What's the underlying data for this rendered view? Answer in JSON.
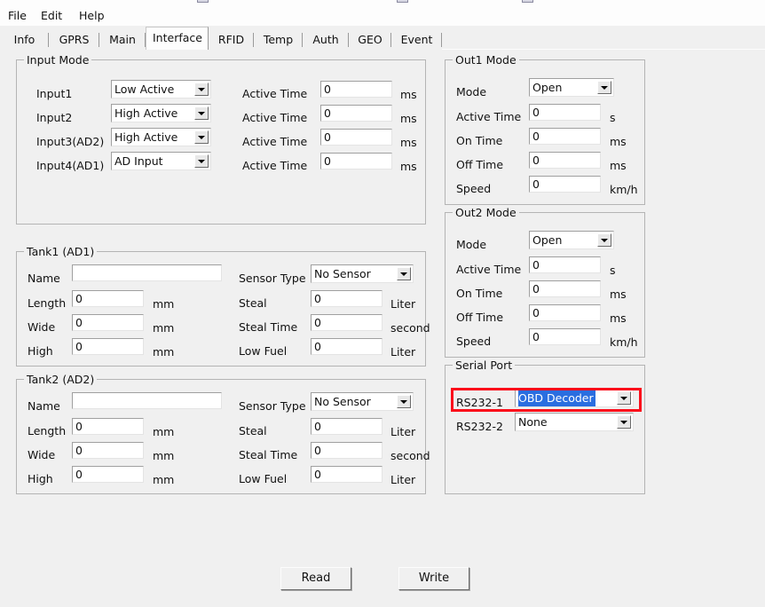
{
  "window": {
    "title_sliver": "",
    "menu": [
      "File",
      "Edit",
      "Help"
    ]
  },
  "tabs": [
    {
      "label": "Info",
      "active": false
    },
    {
      "label": "GPRS",
      "active": false
    },
    {
      "label": "Main",
      "active": false
    },
    {
      "label": "Interface",
      "active": true
    },
    {
      "label": "RFID",
      "active": false
    },
    {
      "label": "Temp",
      "active": false
    },
    {
      "label": "Auth",
      "active": false
    },
    {
      "label": "GEO",
      "active": false
    },
    {
      "label": "Event",
      "active": false
    }
  ],
  "input_mode": {
    "title": "Input Mode",
    "active_time_label": "Active Time",
    "unit_ms": "ms",
    "rows": [
      {
        "label": "Input1",
        "mode": "Low Active",
        "active_time": "0"
      },
      {
        "label": "Input2",
        "mode": "High Active",
        "active_time": "0"
      },
      {
        "label": "Input3(AD2)",
        "mode": "High Active",
        "active_time": "0"
      },
      {
        "label": "Input4(AD1)",
        "mode": "AD Input",
        "active_time": "0"
      }
    ]
  },
  "out1_mode": {
    "title": "Out1 Mode",
    "mode_label": "Mode",
    "mode_value": "Open",
    "fields": [
      {
        "label": "Active Time",
        "value": "0",
        "unit": "s"
      },
      {
        "label": "On Time",
        "value": "0",
        "unit": "ms"
      },
      {
        "label": "Off Time",
        "value": "0",
        "unit": "ms"
      },
      {
        "label": "Speed",
        "value": "0",
        "unit": "km/h"
      }
    ]
  },
  "out2_mode": {
    "title": "Out2 Mode",
    "mode_label": "Mode",
    "mode_value": "Open",
    "fields": [
      {
        "label": "Active Time",
        "value": "0",
        "unit": "s"
      },
      {
        "label": "On Time",
        "value": "0",
        "unit": "ms"
      },
      {
        "label": "Off Time",
        "value": "0",
        "unit": "ms"
      },
      {
        "label": "Speed",
        "value": "0",
        "unit": "km/h"
      }
    ]
  },
  "tank1": {
    "title": "Tank1 (AD1)",
    "name_label": "Name",
    "name_value": "",
    "sensor_type_label": "Sensor Type",
    "sensor_type_value": "No Sensor",
    "left_fields": [
      {
        "label": "Length",
        "value": "0",
        "unit": "mm"
      },
      {
        "label": "Wide",
        "value": "0",
        "unit": "mm"
      },
      {
        "label": "High",
        "value": "0",
        "unit": "mm"
      }
    ],
    "right_fields": [
      {
        "label": "Steal",
        "value": "0",
        "unit": "Liter"
      },
      {
        "label": "Steal Time",
        "value": "0",
        "unit": "second"
      },
      {
        "label": "Low Fuel",
        "value": "0",
        "unit": "Liter"
      }
    ]
  },
  "tank2": {
    "title": "Tank2 (AD2)",
    "name_label": "Name",
    "name_value": "",
    "sensor_type_label": "Sensor Type",
    "sensor_type_value": "No Sensor",
    "left_fields": [
      {
        "label": "Length",
        "value": "0",
        "unit": "mm"
      },
      {
        "label": "Wide",
        "value": "0",
        "unit": "mm"
      },
      {
        "label": "High",
        "value": "0",
        "unit": "mm"
      }
    ],
    "right_fields": [
      {
        "label": "Steal",
        "value": "0",
        "unit": "Liter"
      },
      {
        "label": "Steal Time",
        "value": "0",
        "unit": "second"
      },
      {
        "label": "Low Fuel",
        "value": "0",
        "unit": "Liter"
      }
    ]
  },
  "serial_port": {
    "title": "Serial Port",
    "rows": [
      {
        "label": "RS232-1",
        "value": "OBD Decoder",
        "selected": true
      },
      {
        "label": "RS232-2",
        "value": "None",
        "selected": false
      }
    ]
  },
  "actions": {
    "read_label": "Read",
    "write_label": "Write"
  },
  "highlight": {
    "color": "#fb0d1b"
  }
}
